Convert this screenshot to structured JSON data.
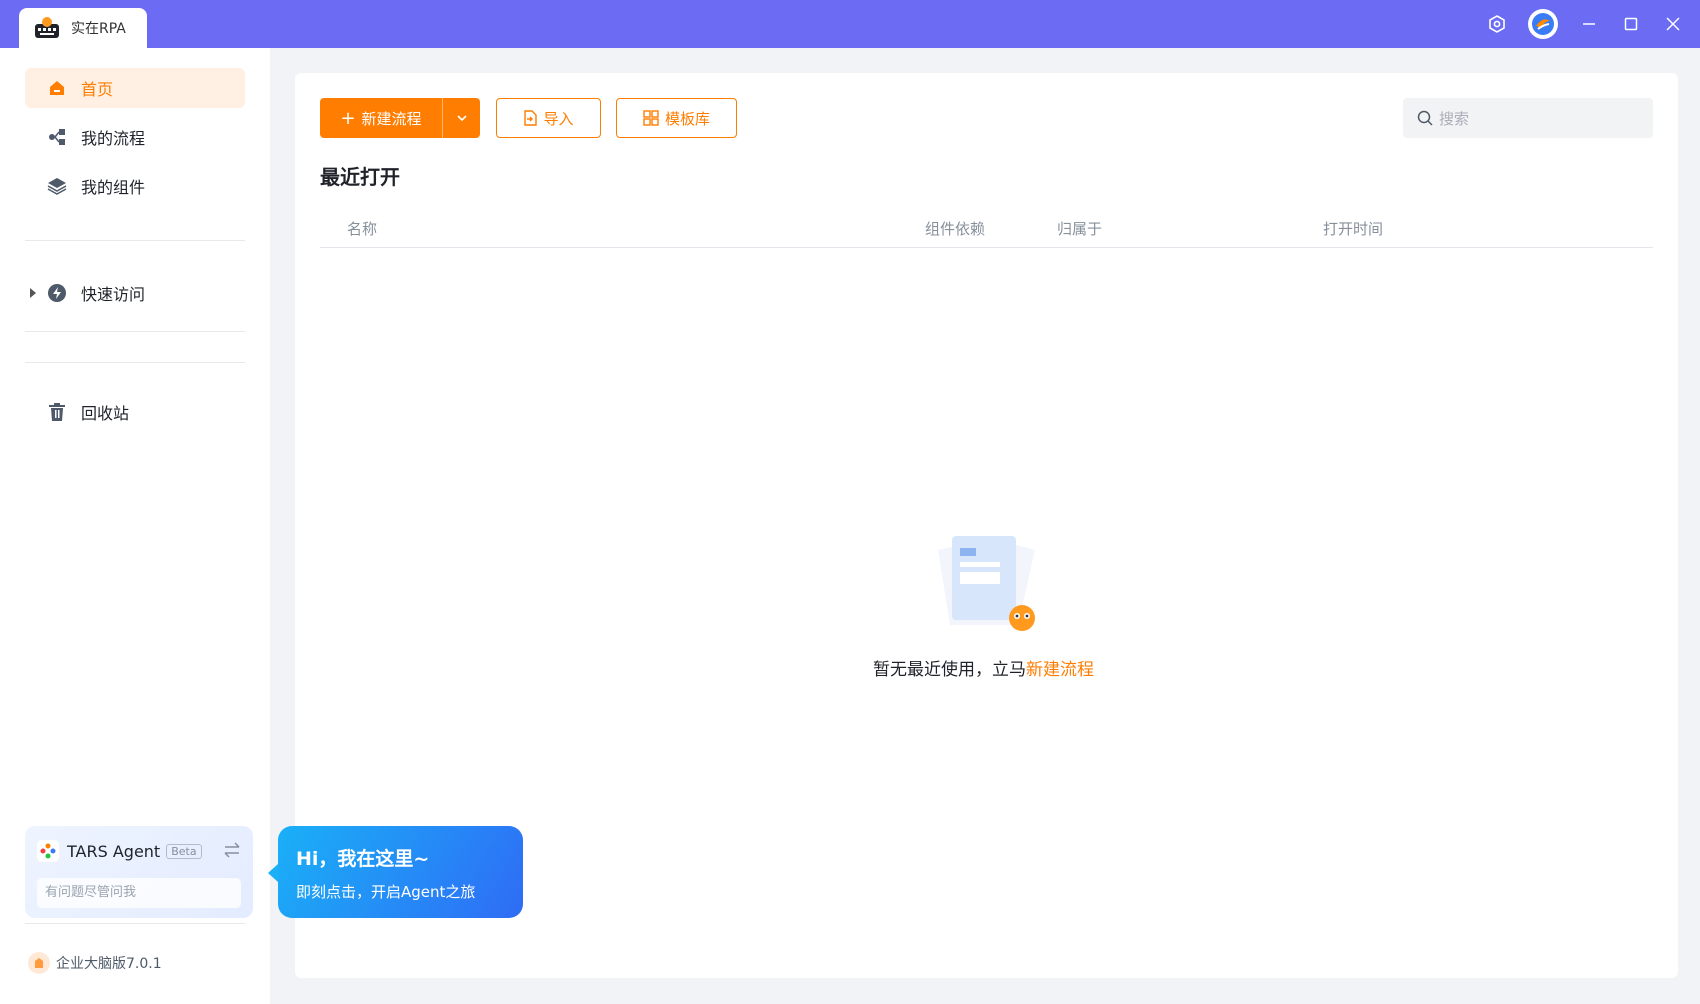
{
  "titlebar": {
    "app_title": "实在RPA",
    "bg_color": "#6b6cf3",
    "icons": [
      "settings-icon",
      "avatar",
      "minimize-icon",
      "maximize-icon",
      "close-icon"
    ]
  },
  "sidebar": {
    "items": [
      {
        "label": "首页",
        "icon": "home-icon",
        "active": true
      },
      {
        "label": "我的流程",
        "icon": "flow-icon"
      },
      {
        "label": "我的组件",
        "icon": "layers-icon"
      },
      {
        "label": "快速访问",
        "icon": "lightning-icon"
      },
      {
        "label": "回收站",
        "icon": "trash-icon"
      }
    ],
    "agent": {
      "title": "TARS Agent",
      "badge": "Beta",
      "placeholder": "有问题尽管问我"
    },
    "version": "企业大脑版7.0.1"
  },
  "bubble": {
    "title": "Hi，我在这里~",
    "subtitle": "即刻点击，开启Agent之旅"
  },
  "toolbar": {
    "new_label": "新建流程",
    "import_label": "导入",
    "template_label": "模板库",
    "search_placeholder": "搜索"
  },
  "recent": {
    "title": "最近打开",
    "columns": [
      "名称",
      "组件依赖",
      "归属于",
      "打开时间"
    ],
    "empty_text": "暂无最近使用，立马",
    "empty_link": "新建流程"
  },
  "accent_color": "#ff7d00"
}
